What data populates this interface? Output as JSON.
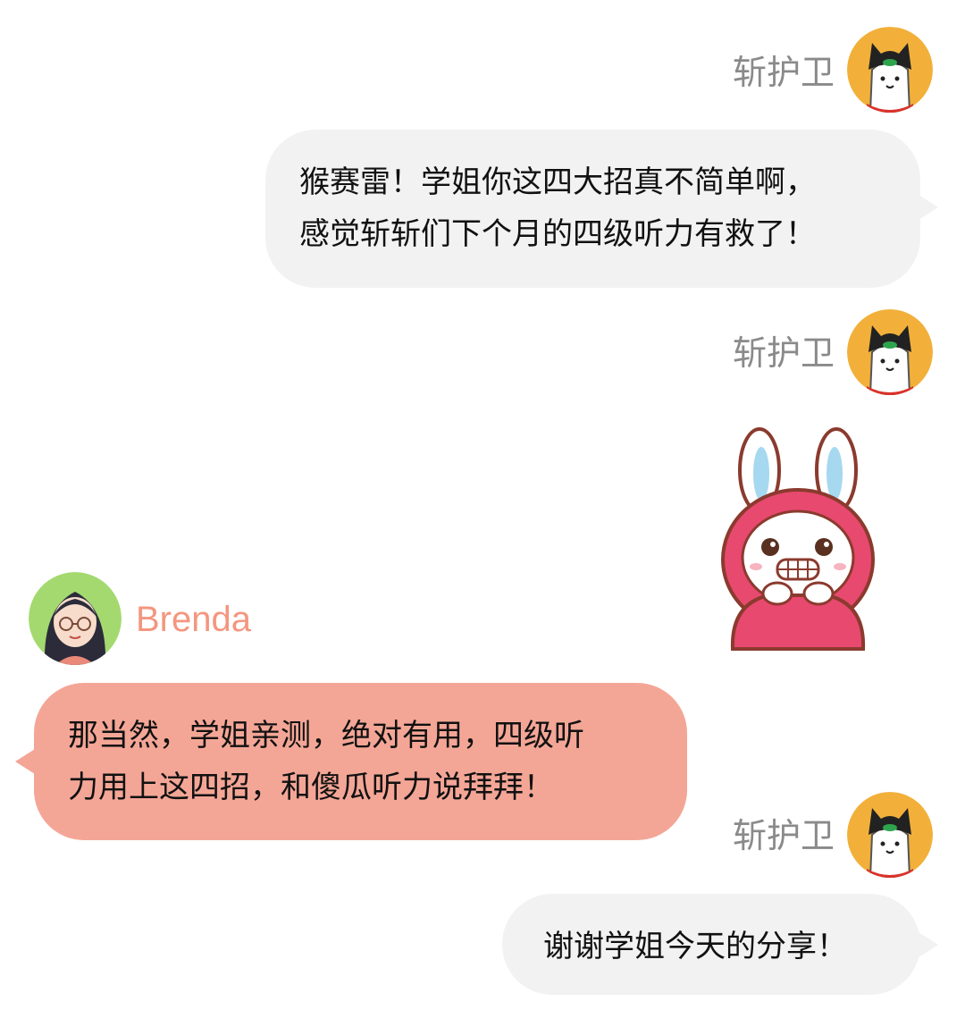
{
  "messages": [
    {
      "sender": "斩护卫",
      "lines": [
        "猴赛雷！学姐你这四大招真不简单啊，",
        "感觉斩斩们下个月的四级听力有救了！"
      ]
    },
    {
      "sender": "斩护卫",
      "sticker": "pink-hooded-bunny-grinning"
    },
    {
      "sender": "Brenda",
      "lines": [
        "那当然，学姐亲测，绝对有用，四级听",
        "力用上这四招，和傻瓜听力说拜拜！"
      ]
    },
    {
      "sender": "斩护卫",
      "lines": [
        "谢谢学姐今天的分享！"
      ]
    }
  ],
  "colors": {
    "self_bubble": "#f2f2f2",
    "other_bubble": "#f4a696",
    "self_name": "#8a8a8a",
    "other_name": "#f4967f"
  },
  "avatars": {
    "self": "cat-guard-avatar",
    "other": "brenda-avatar"
  }
}
